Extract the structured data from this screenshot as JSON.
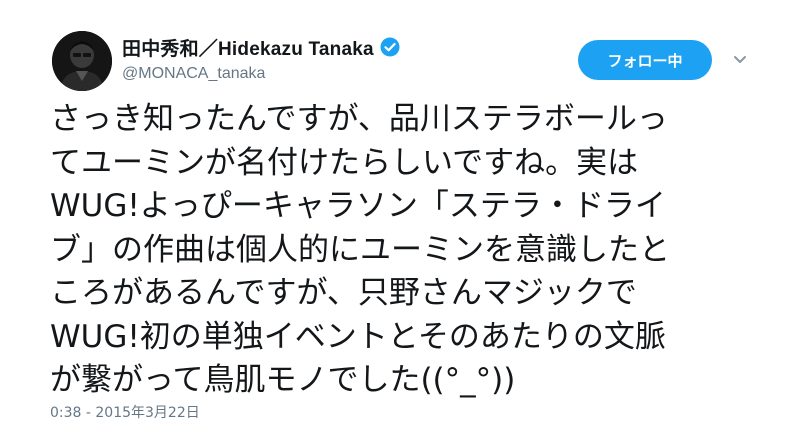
{
  "user": {
    "display_name": "田中秀和／Hidekazu Tanaka",
    "handle": "@MONACA_tanaka",
    "verified": true,
    "avatar_icon": "user-avatar-photo"
  },
  "actions": {
    "follow_label": "フォロー中",
    "more_icon": "chevron-down-icon"
  },
  "tweet": {
    "lines": [
      "さっき知ったんですが、品川ステラボールっ",
      "てユーミンが名付けたらしいですね。実は",
      "WUG!よっぴーキャラソン「ステラ・ドライ",
      "ブ」の作曲は個人的にユーミンを意識したと",
      "ころがあるんですが、只野さんマジックで",
      "WUG!初の単独イベントとそのあたりの文脈",
      "が繋がって鳥肌モノでした((°_°))"
    ],
    "timestamp": "0:38 - 2015年3月22日"
  },
  "colors": {
    "accent": "#1da1f2",
    "text": "#14171a",
    "secondary": "#657786"
  }
}
